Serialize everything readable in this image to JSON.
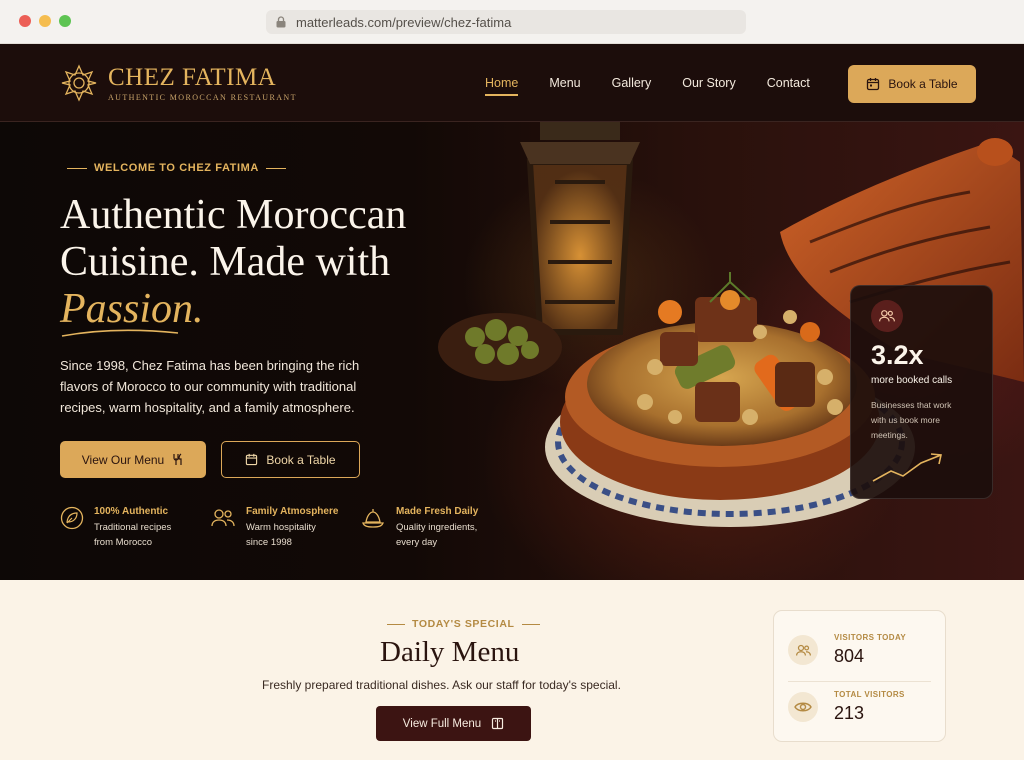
{
  "browser": {
    "url": "matterleads.com/preview/chez-fatima"
  },
  "brand": {
    "name": "CHEZ FATIMA",
    "tagline": "AUTHENTIC MOROCCAN RESTAURANT"
  },
  "nav": {
    "items": [
      {
        "label": "Home",
        "active": true
      },
      {
        "label": "Menu",
        "active": false
      },
      {
        "label": "Gallery",
        "active": false
      },
      {
        "label": "Our Story",
        "active": false
      },
      {
        "label": "Contact",
        "active": false
      }
    ],
    "cta": "Book a Table"
  },
  "hero": {
    "eyebrow": "WELCOME TO CHEZ FATIMA",
    "title_line1": "Authentic Moroccan",
    "title_line2": "Cuisine. Made with",
    "title_accent": "Passion.",
    "paragraph": "Since 1998, Chez Fatima has been bringing the rich flavors of Morocco to our community with traditional recipes, warm hospitality, and a family atmosphere.",
    "primary_button": "View Our Menu",
    "secondary_button": "Book a Table",
    "features": [
      {
        "title": "100% Authentic",
        "line1": "Traditional recipes",
        "line2": "from Morocco",
        "icon": "leaf-icon"
      },
      {
        "title": "Family Atmosphere",
        "line1": "Warm hospitality",
        "line2": "since 1998",
        "icon": "users-icon"
      },
      {
        "title": "Made Fresh Daily",
        "line1": "Quality ingredients,",
        "line2": "every day",
        "icon": "tagine-icon"
      }
    ]
  },
  "stat_card": {
    "value": "3.2x",
    "label": "more booked calls",
    "desc_line1": "Businesses that work",
    "desc_line2": "with us book more",
    "desc_line3": "meetings."
  },
  "lower": {
    "eyebrow": "TODAY'S SPECIAL",
    "title": "Daily Menu",
    "subtitle": "Freshly prepared traditional dishes. Ask our staff for today's special.",
    "button": "View Full Menu"
  },
  "visitors": {
    "today_label": "VISITORS TODAY",
    "today_value": "804",
    "total_label": "TOTAL VISITORS",
    "total_value": "213"
  },
  "colors": {
    "gold": "#dca859",
    "dark_maroon": "#1c0d0b",
    "cream": "#fbf3e7",
    "button_maroon": "#3c1412"
  }
}
